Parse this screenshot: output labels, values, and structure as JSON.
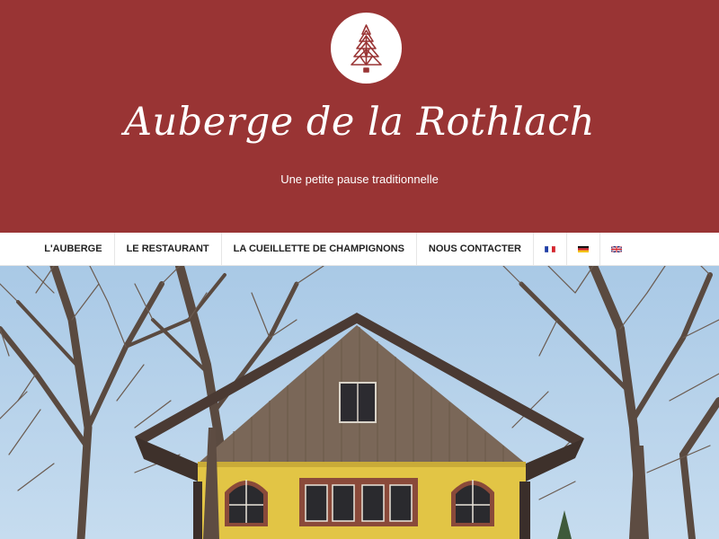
{
  "header": {
    "title": "Auberge de la Rothlach",
    "tagline": "Une petite pause traditionnelle",
    "logo_icon": "fir-tree-icon",
    "background_color": "#993434"
  },
  "nav": {
    "items": [
      {
        "label": "L'AUBERGE"
      },
      {
        "label": "LE RESTAURANT"
      },
      {
        "label": "LA CUEILLETTE DE CHAMPIGNONS"
      },
      {
        "label": "NOUS CONTACTER"
      }
    ],
    "languages": [
      {
        "icon": "flag-fr-icon"
      },
      {
        "icon": "flag-de-icon"
      },
      {
        "icon": "flag-en-icon"
      }
    ]
  },
  "hero": {
    "description_icon": "inn-photo"
  }
}
